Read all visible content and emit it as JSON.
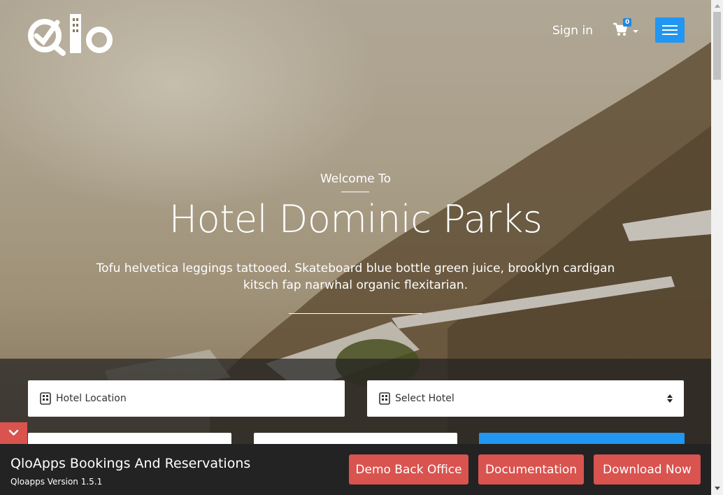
{
  "header": {
    "logo_text": "Qlo",
    "signin_label": "Sign in",
    "cart_count": "0",
    "menu_icon": "hamburger-icon",
    "accent_color": "#2196f3"
  },
  "hero": {
    "welcome": "Welcome To",
    "title": "Hotel Dominic Parks",
    "description": "Tofu helvetica leggings tattooed. Skateboard blue bottle green juice, brooklyn cardigan kitsch fap narwhal organic flexitarian."
  },
  "booking": {
    "location_placeholder": "Hotel Location",
    "hotel_select": "Select Hotel"
  },
  "footer": {
    "title": "QloApps Bookings And Reservations",
    "version": "Qloapps Version 1.5.1",
    "buttons": [
      "Demo Back Office",
      "Documentation",
      "Download Now"
    ],
    "button_color": "#d9534f"
  }
}
